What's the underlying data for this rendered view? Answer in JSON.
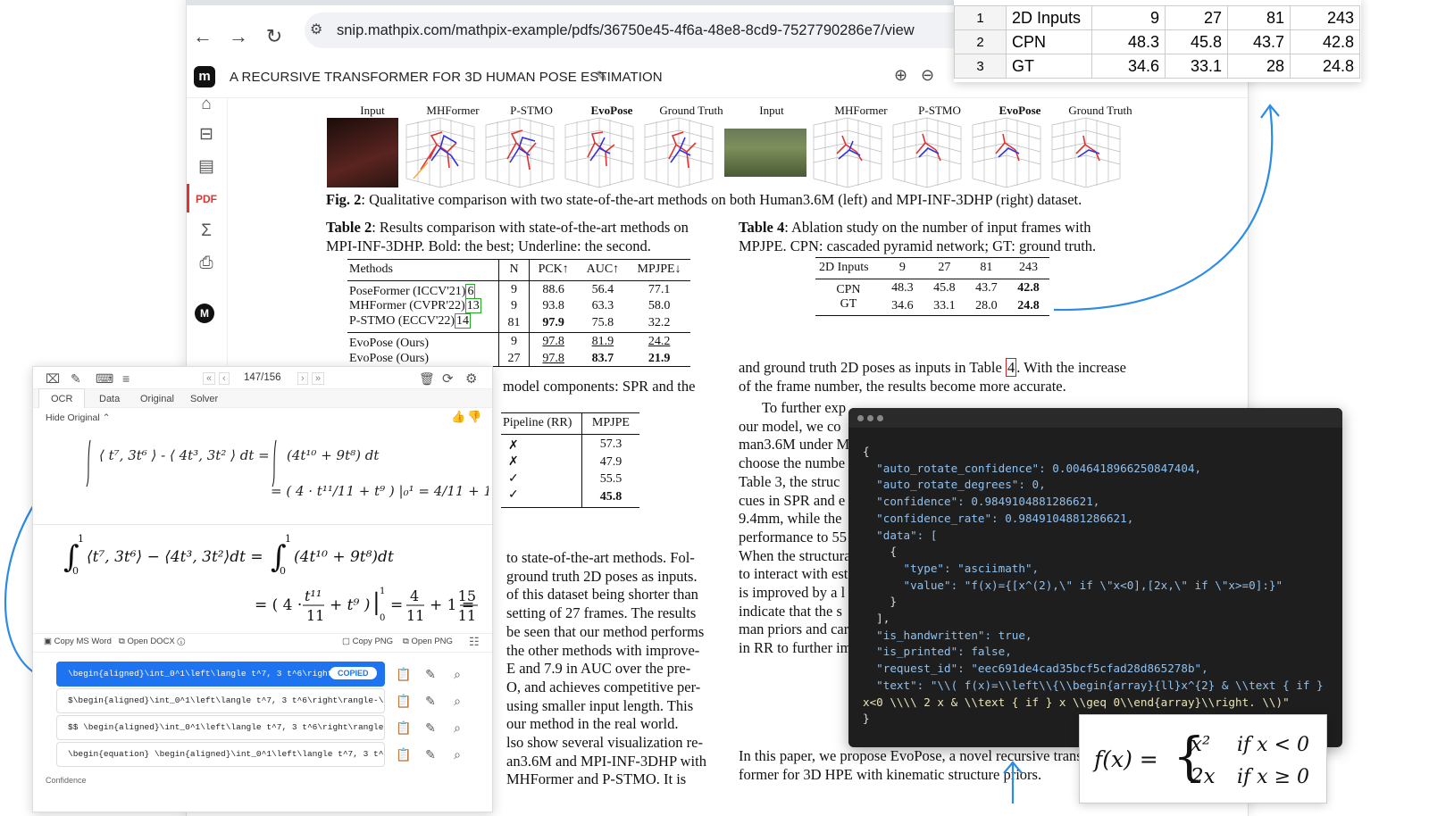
{
  "browser": {
    "url": "snip.mathpix.com/mathpix-example/pdfs/36750e45-4f6a-48e8-8cd9-7527790286e7/view",
    "doc_title": "A RECURSIVE TRANSFORMER FOR 3D HUMAN POSE ESTIMATION",
    "app_logo": "m",
    "avatar": "M"
  },
  "figure": {
    "labels": [
      "Input",
      "MHFormer",
      "P-STMO",
      "EvoPose",
      "Ground Truth",
      "Input",
      "MHFormer",
      "P-STMO",
      "EvoPose",
      "Ground Truth"
    ],
    "caption_bold": "Fig. 2",
    "caption": ": Qualitative comparison with two state-of-the-art methods on both Human3.6M (left) and MPI-INF-3DHP (right) dataset."
  },
  "table2": {
    "caption_bold": "Table 2",
    "caption": ": Results comparison with state-of-the-art methods on MPI-INF-3DHP. Bold: the best; Underline: the second.",
    "headers": [
      "Methods",
      "N",
      "PCK↑",
      "AUC↑",
      "MPJPE↓"
    ],
    "rows": [
      [
        "PoseFormer (ICCV'21)",
        "6",
        "9",
        "88.6",
        "56.4",
        "77.1"
      ],
      [
        "MHFormer (CVPR'22)",
        "13",
        "9",
        "93.8",
        "63.3",
        "58.0"
      ],
      [
        "P-STMO (ECCV'22)",
        "14",
        "81",
        "97.9",
        "75.8",
        "32.2"
      ],
      [
        "EvoPose (Ours)",
        "",
        "9",
        "97.8",
        "81.9",
        "24.2"
      ],
      [
        "EvoPose (Ours)",
        "",
        "27",
        "97.8",
        "83.7",
        "21.9"
      ]
    ]
  },
  "table4": {
    "caption_bold": "Table 4",
    "caption": ": Ablation study on the number of input frames with MPJPE. CPN: cascaded pyramid network; GT: ground truth.",
    "header": [
      "2D Inputs",
      "9",
      "27",
      "81",
      "243"
    ],
    "rows": [
      [
        "CPN",
        "48.3",
        "45.8",
        "43.7",
        "42.8"
      ],
      [
        "GT",
        "34.6",
        "33.1",
        "28.0",
        "24.8"
      ]
    ]
  },
  "table3_partial": {
    "caption_tail": "model components: SPR and the",
    "headers": [
      "Pipeline (RR)",
      "MPJPE"
    ],
    "rows": [
      [
        "✗",
        "57.3"
      ],
      [
        "✗",
        "47.9"
      ],
      [
        "✓",
        "55.5"
      ],
      [
        "✓",
        "45.8"
      ]
    ]
  },
  "right_text": {
    "p1a": "and ground truth 2D poses as inputs in Table",
    "p1ref": "4",
    "p1b": ". With the increase of the frame number, the results become more accurate.",
    "lines": [
      "To further exp",
      "our model, we co",
      "man3.6M under M",
      "choose the numbe",
      "Table 3, the struc",
      "cues in SPR and e",
      "9.4mm, while the",
      "performance to 55",
      "When the structura",
      "to interact with est",
      "is improved by a l",
      "indicate that the s",
      "man priors and car",
      "in RR to further im"
    ],
    "bottom": "In this paper, we propose EvoPose, a novel recursive trans-",
    "bottom2": "former for 3D HPE with kinematic structure priors."
  },
  "left_text": {
    "lines": [
      "to state-of-the-art methods. Fol-",
      "ground truth 2D poses as inputs.",
      "of this dataset being shorter than",
      "setting of 27 frames. The results",
      "be seen that our method performs",
      "the other methods with improve-",
      "E and 7.9 in AUC over the pre-",
      "O, and achieves competitive per-",
      "using smaller input length. This",
      "our method in the real world.",
      "lso show several visualization re-",
      "an3.6M and MPI-INF-3DHP with",
      "MHFormer and P-STMO. It is"
    ]
  },
  "sheet": {
    "rows": [
      [
        "1",
        "2D Inputs",
        "9",
        "27",
        "81",
        "243"
      ],
      [
        "2",
        "CPN",
        "48.3",
        "45.8",
        "43.7",
        "42.8"
      ],
      [
        "3",
        "GT",
        "34.6",
        "33.1",
        "28",
        "24.8"
      ]
    ]
  },
  "ocr_panel": {
    "page_counter": "147/156",
    "tabs": [
      "OCR",
      "Data",
      "Original",
      "Solver"
    ],
    "hide_original": "Hide Original",
    "copy_ms_word": "Copy MS Word",
    "open_docx": "Open DOCX",
    "copy_png": "Copy PNG",
    "open_png": "Open PNG",
    "copied_badge": "COPIED",
    "confidence_label": "Confidence",
    "latex_rows": [
      "\\begin{aligned}\\int_0^1\\left\\langle t^7, 3 t^6\\right\\ran…",
      "$\\begin{aligned}\\int_0^1\\left\\langle t^7, 3 t^6\\right\\rangle-\\left\\…",
      "$$ \\begin{aligned}\\int_0^1\\left\\langle t^7, 3 t^6\\right\\rangle-\\left…",
      "\\begin{equation} \\begin{aligned}\\int_0^1\\left\\langle t^7, 3 t^6\\righ…"
    ]
  },
  "json_panel": {
    "lines": [
      "{",
      "  \"auto_rotate_confidence\": 0.0046418966250847404,",
      "  \"auto_rotate_degrees\": 0,",
      "  \"confidence\": 0.9849104881286621,",
      "  \"confidence_rate\": 0.9849104881286621,",
      "  \"data\": [",
      "    {",
      "      \"type\": \"asciimath\",",
      "      \"value\": \"f(x)={[x^(2),\\\" if \\\"x<0],[2x,\\\" if \\\"x>=0]:}\"",
      "    }",
      "  ],",
      "  \"is_handwritten\": true,",
      "  \"is_printed\": false,",
      "  \"request_id\": \"eec691de4cad35bcf5cfad28d865278b\",",
      "  \"text\": \"\\\\( f(x)=\\\\left\\\\{\\\\begin{array}{ll}x^{2} & \\\\text { if }",
      "x<0 \\\\\\\\ 2 x & \\\\text { if } x \\\\geq 0\\\\end{array}\\\\right. \\\\)\"",
      "}"
    ]
  }
}
